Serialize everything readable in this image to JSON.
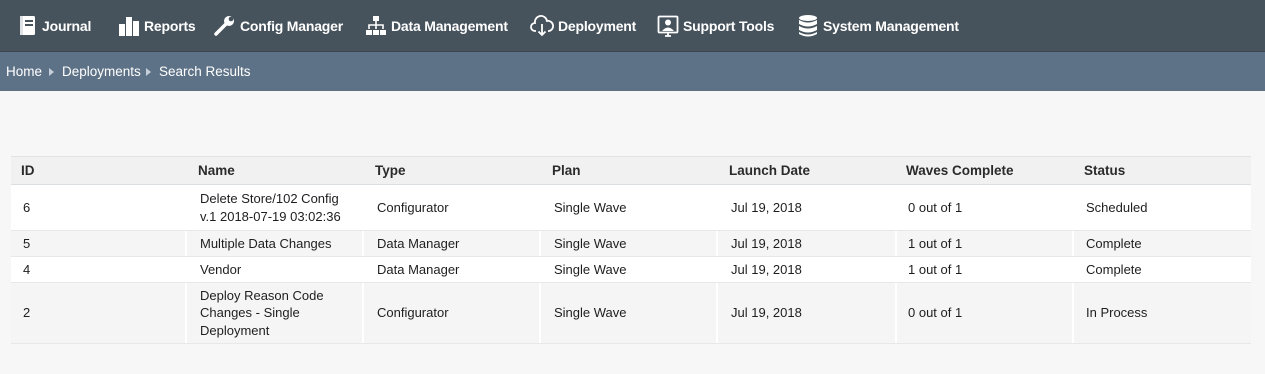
{
  "nav": {
    "items": [
      {
        "label": "Journal",
        "icon": "journal-icon"
      },
      {
        "label": "Reports",
        "icon": "bar-chart-icon"
      },
      {
        "label": "Config Manager",
        "icon": "wrench-icon"
      },
      {
        "label": "Data Management",
        "icon": "sitemap-icon"
      },
      {
        "label": "Deployment",
        "icon": "cloud-download-icon"
      },
      {
        "label": "Support Tools",
        "icon": "user-monitor-icon"
      },
      {
        "label": "System Management",
        "icon": "database-icon"
      }
    ]
  },
  "breadcrumb": {
    "items": [
      "Home",
      "Deployments",
      "Search Results"
    ]
  },
  "table": {
    "headers": [
      "ID",
      "Name",
      "Type",
      "Plan",
      "Launch Date",
      "Waves Complete",
      "Status"
    ],
    "rows": [
      {
        "id": "6",
        "name_lines": [
          "Delete Store/102 Config",
          "v.1 2018-07-19 03:02:36"
        ],
        "type": "Configurator",
        "plan": "Single Wave",
        "launch_date": "Jul 19, 2018",
        "waves": "0 out of 1",
        "status": "Scheduled"
      },
      {
        "id": "5",
        "name_lines": [
          "Multiple Data Changes"
        ],
        "type": "Data Manager",
        "plan": "Single Wave",
        "launch_date": "Jul 19, 2018",
        "waves": "1 out of 1",
        "status": "Complete"
      },
      {
        "id": "4",
        "name_lines": [
          "Vendor"
        ],
        "type": "Data Manager",
        "plan": "Single Wave",
        "launch_date": "Jul 19, 2018",
        "waves": "1 out of 1",
        "status": "Complete"
      },
      {
        "id": "2",
        "name_lines": [
          "Deploy Reason Code",
          "Changes - Single",
          "Deployment"
        ],
        "type": "Configurator",
        "plan": "Single Wave",
        "launch_date": "Jul 19, 2018",
        "waves": "0 out of 1",
        "status": "In Process"
      }
    ]
  }
}
